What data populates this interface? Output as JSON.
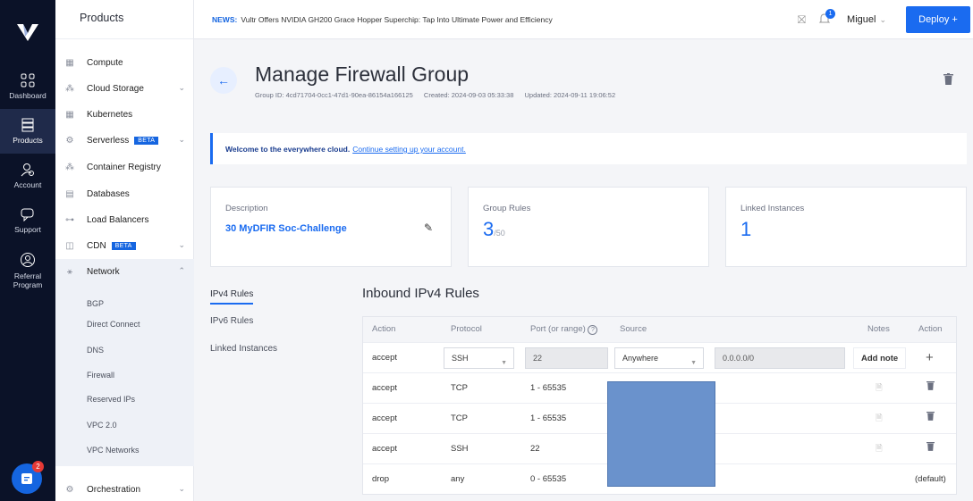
{
  "rail": {
    "items": [
      {
        "label": "Dashboard"
      },
      {
        "label": "Products"
      },
      {
        "label": "Account"
      },
      {
        "label": "Support"
      },
      {
        "label": "Referral Program"
      }
    ],
    "chat_badge": "2"
  },
  "sidebar": {
    "title": "Products",
    "items": [
      {
        "label": "Compute"
      },
      {
        "label": "Cloud Storage"
      },
      {
        "label": "Kubernetes"
      },
      {
        "label": "Serverless",
        "badge": "BETA"
      },
      {
        "label": "Container Registry"
      },
      {
        "label": "Databases"
      },
      {
        "label": "Load Balancers"
      },
      {
        "label": "CDN",
        "badge": "BETA"
      },
      {
        "label": "Network"
      },
      {
        "label": "Orchestration"
      }
    ],
    "network_sub": [
      "BGP",
      "Direct Connect",
      "DNS",
      "Firewall",
      "Reserved IPs",
      "VPC 2.0",
      "VPC Networks"
    ]
  },
  "topbar": {
    "news_label": "NEWS:",
    "news_text": "Vultr Offers NVIDIA GH200 Grace Hopper Superchip: Tap Into Ultimate Power and Efficiency",
    "notification_count": "1",
    "user": "Miguel",
    "deploy_label": "Deploy +"
  },
  "page": {
    "title": "Manage Firewall Group",
    "group_id": "Group ID: 4cd71704-0cc1-47d1-90ea-86154a166125",
    "created": "Created: 2024-09-03 05:33:38",
    "updated": "Updated: 2024-09-11 19:06:52"
  },
  "welcome": {
    "bold": "Welcome to the everywhere cloud.",
    "link": "Continue setting up your account."
  },
  "cards": {
    "description_label": "Description",
    "description_value": "30 MyDFIR Soc-Challenge",
    "rules_label": "Group Rules",
    "rules_value": "3",
    "rules_max": "/50",
    "instances_label": "Linked Instances",
    "instances_value": "1"
  },
  "tabs": [
    "IPv4 Rules",
    "IPv6 Rules",
    "Linked Instances"
  ],
  "rules": {
    "title": "Inbound IPv4 Rules",
    "headers": [
      "Action",
      "Protocol",
      "Port (or range)",
      "Source",
      "Notes",
      "Action"
    ],
    "new_rule": {
      "action": "accept",
      "protocol": "SSH",
      "port": "22",
      "source": "Anywhere",
      "cidr": "0.0.0.0/0",
      "add_note": "Add note"
    },
    "rows": [
      {
        "action": "accept",
        "protocol": "TCP",
        "port": "1 - 65535"
      },
      {
        "action": "accept",
        "protocol": "TCP",
        "port": "1 - 65535"
      },
      {
        "action": "accept",
        "protocol": "SSH",
        "port": "22"
      },
      {
        "action": "drop",
        "protocol": "any",
        "port": "0 - 65535",
        "note": "(default)"
      }
    ]
  },
  "colors": {
    "accent": "#1a6bf0",
    "rail_bg": "#0b1228",
    "redaction": "#6a92cc"
  }
}
